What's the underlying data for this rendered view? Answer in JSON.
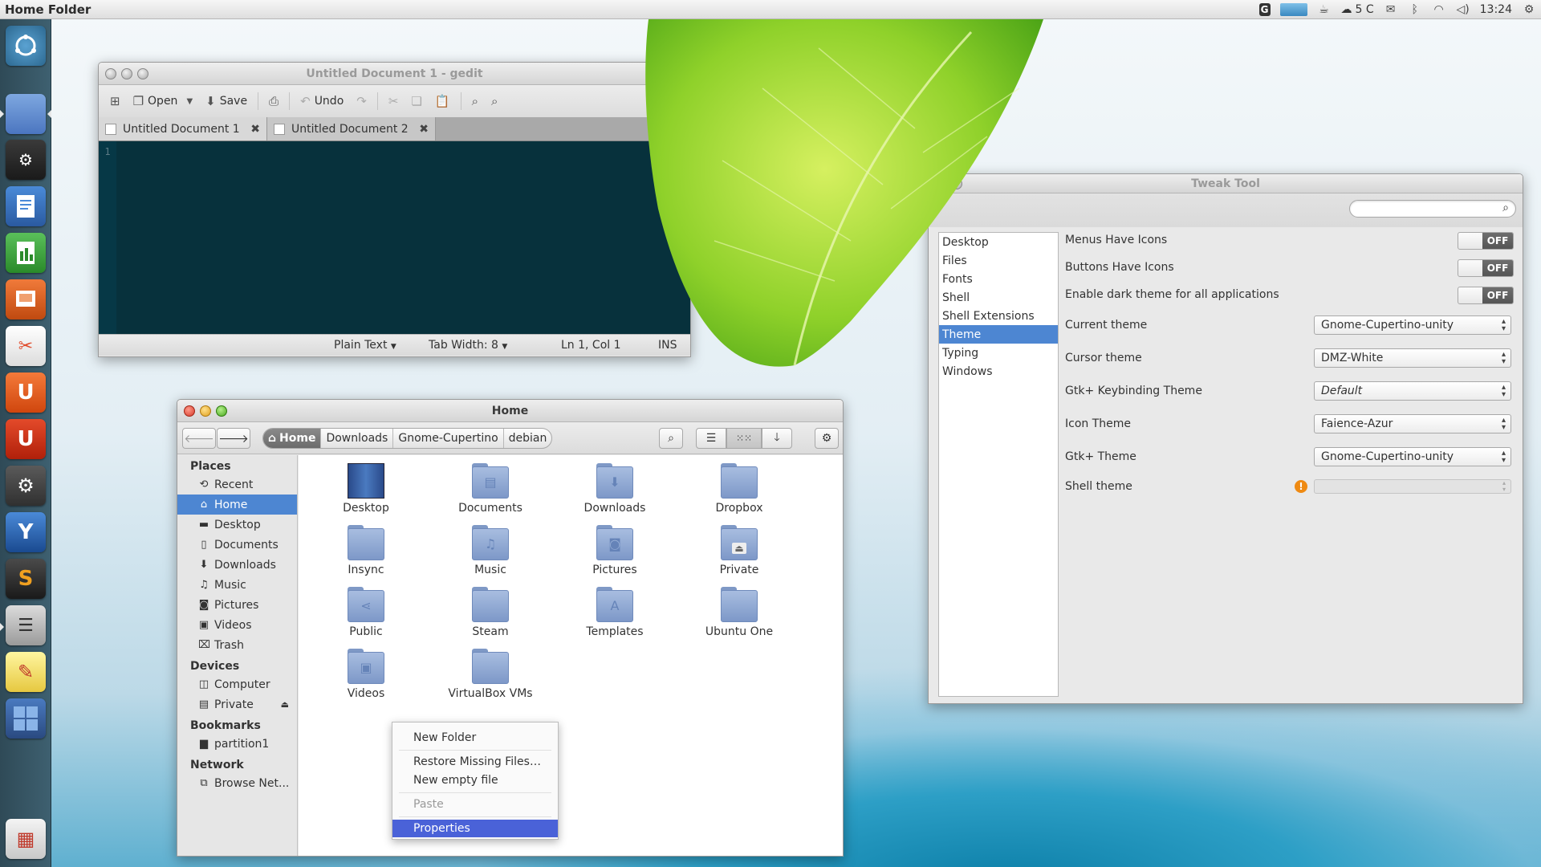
{
  "top_panel": {
    "title": "Home Folder",
    "tray": {
      "temperature": "5 C",
      "clock": "13:24"
    }
  },
  "launcher": {
    "items": [
      {
        "icon": "dash-home-icon"
      },
      {
        "icon": "files-icon"
      },
      {
        "icon": "steam-icon"
      },
      {
        "icon": "writer-icon"
      },
      {
        "icon": "calc-icon"
      },
      {
        "icon": "impress-icon"
      },
      {
        "icon": "tools-icon"
      },
      {
        "icon": "ubuntu-software-center-icon",
        "glyph": "U"
      },
      {
        "icon": "update-manager-icon",
        "glyph": "U"
      },
      {
        "icon": "system-settings-icon"
      },
      {
        "icon": "y-ppa-manager-icon",
        "glyph": "Y"
      },
      {
        "icon": "sublime-text-icon",
        "glyph": "S"
      },
      {
        "icon": "mixer-icon"
      },
      {
        "icon": "text-editor-icon"
      },
      {
        "icon": "workspace-switcher-icon"
      },
      {
        "icon": "trash-icon"
      }
    ]
  },
  "gedit": {
    "title": "Untitled Document 1 - gedit",
    "toolbar": {
      "open": "Open",
      "save": "Save",
      "undo": "Undo"
    },
    "tabs": [
      {
        "label": "Untitled Document 1"
      },
      {
        "label": "Untitled Document 2"
      }
    ],
    "line_number": "1",
    "status": {
      "language": "Plain Text",
      "tab_width": "Tab Width:  8",
      "position": "Ln 1, Col 1",
      "mode": "INS"
    }
  },
  "nautilus": {
    "title": "Home",
    "breadcrumbs": [
      "Home",
      "Downloads",
      "Gnome-Cupertino",
      "debian"
    ],
    "sidebar": {
      "places_header": "Places",
      "places": [
        {
          "label": "Recent",
          "icon": "recent-icon"
        },
        {
          "label": "Home",
          "icon": "home-icon",
          "selected": true
        },
        {
          "label": "Desktop",
          "icon": "desktop-icon"
        },
        {
          "label": "Documents",
          "icon": "documents-icon"
        },
        {
          "label": "Downloads",
          "icon": "downloads-icon"
        },
        {
          "label": "Music",
          "icon": "music-icon"
        },
        {
          "label": "Pictures",
          "icon": "pictures-icon"
        },
        {
          "label": "Videos",
          "icon": "videos-icon"
        },
        {
          "label": "Trash",
          "icon": "trash-icon"
        }
      ],
      "devices_header": "Devices",
      "devices": [
        {
          "label": "Computer",
          "icon": "computer-icon"
        },
        {
          "label": "Private",
          "icon": "drive-icon"
        }
      ],
      "bookmarks_header": "Bookmarks",
      "bookmarks": [
        {
          "label": "partition1",
          "icon": "folder-icon"
        }
      ],
      "network_header": "Network",
      "network": [
        {
          "label": "Browse Net...",
          "icon": "network-icon"
        }
      ]
    },
    "files": [
      {
        "label": "Desktop"
      },
      {
        "label": "Documents"
      },
      {
        "label": "Downloads"
      },
      {
        "label": "Dropbox"
      },
      {
        "label": "Insync"
      },
      {
        "label": "Music"
      },
      {
        "label": "Pictures"
      },
      {
        "label": "Private"
      },
      {
        "label": "Public"
      },
      {
        "label": "Steam"
      },
      {
        "label": "Templates"
      },
      {
        "label": "Ubuntu One"
      },
      {
        "label": "Videos"
      },
      {
        "label": "VirtualBox VMs"
      }
    ],
    "context_menu": {
      "new_folder": "New Folder",
      "restore": "Restore Missing Files…",
      "new_file": "New empty file",
      "paste": "Paste",
      "properties": "Properties"
    }
  },
  "tweak": {
    "title": "Tweak Tool",
    "search_placeholder": "",
    "categories": [
      "Desktop",
      "Files",
      "Fonts",
      "Shell",
      "Shell Extensions",
      "Theme",
      "Typing",
      "Windows"
    ],
    "selected_category": "Theme",
    "toggle_off": "OFF",
    "settings": {
      "menus_icons": "Menus Have Icons",
      "buttons_icons": "Buttons Have Icons",
      "dark_theme": "Enable dark theme for all applications",
      "current_theme_label": "Current theme",
      "current_theme_value": "Gnome-Cupertino-unity",
      "cursor_theme_label": "Cursor theme",
      "cursor_theme_value": "DMZ-White",
      "keybinding_label": "Gtk+ Keybinding Theme",
      "keybinding_value": "Default",
      "icon_theme_label": "Icon Theme",
      "icon_theme_value": "Faience-Azur",
      "gtk_theme_label": "Gtk+ Theme",
      "gtk_theme_value": "Gnome-Cupertino-unity",
      "shell_theme_label": "Shell theme",
      "shell_theme_value": ""
    }
  }
}
